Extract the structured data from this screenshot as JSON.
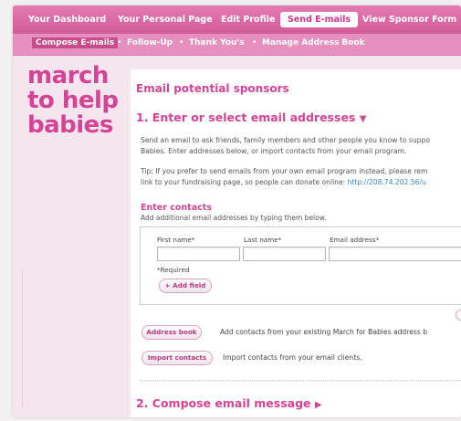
{
  "topnav": {
    "tabs": [
      {
        "label": "Your Dashboard"
      },
      {
        "label": "Your Personal Page"
      },
      {
        "label": "Edit Profile"
      },
      {
        "label": "Send E-mails"
      },
      {
        "label": "View Sponsor Form"
      }
    ],
    "active": "Send E-mails"
  },
  "subnav": {
    "items": [
      {
        "label": "Compose E-mails"
      },
      {
        "label": "Follow-Up"
      },
      {
        "label": "Thank You's"
      },
      {
        "label": "Manage Address Book"
      }
    ],
    "separator": "•"
  },
  "logo": {
    "line1": "march",
    "line2": "to help",
    "line3": "babies"
  },
  "main": {
    "title": "Email potential sponsors",
    "step1": {
      "title": "1. Enter or select email addresses",
      "arrow": "▼"
    },
    "intro_line1": "Send an email to ask friends, family members and other people you know to suppo",
    "intro_line2": "Babies. Enter addresses below, or import contacts from your email program.",
    "tip_line1": "Tip: If you prefer to send emails from your own email program instead, please rem",
    "tip_line2_prefix": "link to your fundraising page, so people can donate online: ",
    "tip_link": "http://208.74.202.56/u",
    "enter_contacts": {
      "title": "Enter contacts",
      "subtitle": "Add additional email addresses by typing them below.",
      "first_name_label": "First name*",
      "last_name_label": "Last name*",
      "email_label": "Email address*",
      "first_name_value": "",
      "last_name_value": "",
      "email_value": "",
      "required_note": "*Required",
      "add_field_button": "+ Add field"
    },
    "address_book": {
      "button": "Address book",
      "description": "Add contacts from your existing March for Babies address b"
    },
    "import_contacts": {
      "button": "Import contacts",
      "description": "Import contacts from your email clients."
    },
    "step2": {
      "title": "2. Compose email message",
      "arrow": "▶"
    }
  }
}
